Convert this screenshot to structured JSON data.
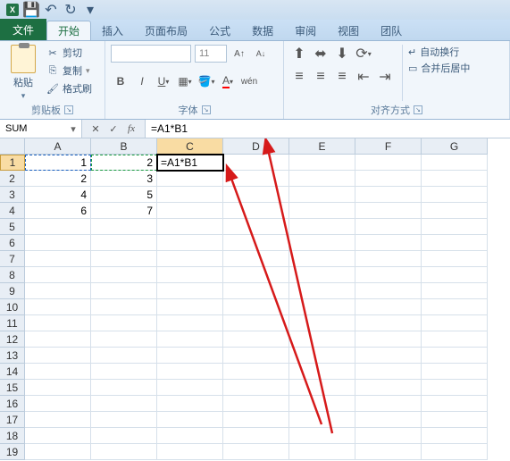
{
  "qat": {
    "save": "💾",
    "undo": "↶",
    "redo": "↷"
  },
  "tabs": {
    "file": "文件",
    "home": "开始",
    "insert": "插入",
    "pagelayout": "页面布局",
    "formulas": "公式",
    "data": "数据",
    "review": "审阅",
    "view": "视图",
    "team": "团队"
  },
  "clipboard": {
    "paste": "粘贴",
    "cut": "剪切",
    "copy": "复制",
    "format_painter": "格式刷",
    "group_label": "剪贴板"
  },
  "font": {
    "size": "11",
    "group_label": "字体"
  },
  "align": {
    "wrap": "自动换行",
    "merge": "合并后居中",
    "group_label": "对齐方式"
  },
  "namebox": "SUM",
  "formula": "=A1*B1",
  "columns": [
    "A",
    "B",
    "C",
    "D",
    "E",
    "F",
    "G"
  ],
  "rows": [
    "1",
    "2",
    "3",
    "4",
    "5",
    "6",
    "7",
    "8",
    "9",
    "10",
    "11",
    "12",
    "13",
    "14",
    "15",
    "16",
    "17",
    "18",
    "19"
  ],
  "cells": {
    "A1": "1",
    "B1": "2",
    "C1": "=A1*B1",
    "A2": "2",
    "B2": "3",
    "A3": "4",
    "B3": "5",
    "A4": "6",
    "B4": "7"
  },
  "chart_data": {
    "type": "table",
    "columns": [
      "A",
      "B"
    ],
    "rows": [
      [
        1,
        2
      ],
      [
        2,
        3
      ],
      [
        4,
        5
      ],
      [
        6,
        7
      ]
    ],
    "formula_cell": {
      "ref": "C1",
      "formula": "=A1*B1"
    }
  }
}
